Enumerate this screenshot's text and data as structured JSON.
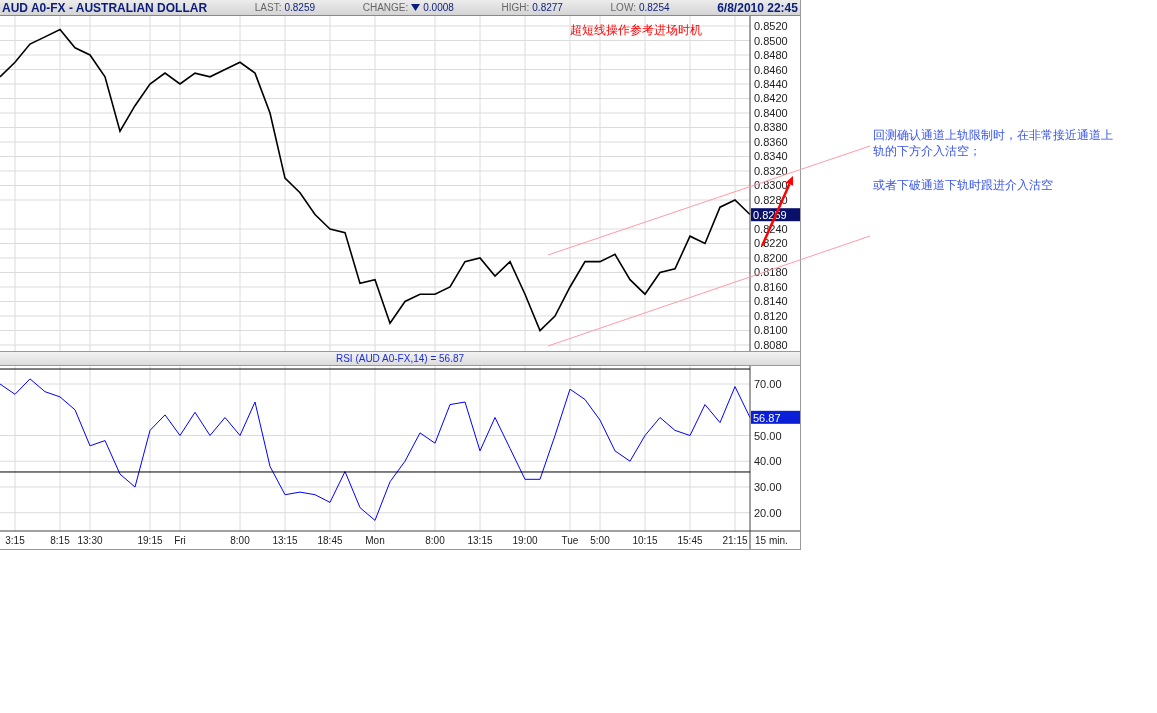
{
  "header": {
    "title": "AUD A0-FX - AUSTRALIAN DOLLAR",
    "fields": [
      {
        "label": "LAST:",
        "value": "0.8259"
      },
      {
        "label": "CHANGE:",
        "value": "0.0008",
        "falling": true
      },
      {
        "label": "HIGH:",
        "value": "0.8277"
      },
      {
        "label": "LOW:",
        "value": "0.8254"
      }
    ],
    "datetime": "6/8/2010 22:45"
  },
  "price_chart": {
    "last_label": "0.8259",
    "overlays": [
      {
        "kind": "channel_line"
      },
      {
        "kind": "channel_line"
      },
      {
        "kind": "arrow"
      }
    ],
    "chart_data": {
      "type": "line",
      "grid": true,
      "series": [
        {
          "color": "#000000",
          "values": [
            0.845,
            0.847,
            0.8495,
            0.8505,
            0.8515,
            0.849,
            0.848,
            0.845,
            0.8375,
            0.841,
            0.844,
            0.8455,
            0.844,
            0.8455,
            0.845,
            0.846,
            0.847,
            0.8455,
            0.84,
            0.831,
            0.829,
            0.826,
            0.824,
            0.8235,
            0.8165,
            0.817,
            0.811,
            0.814,
            0.815,
            0.815,
            0.816,
            0.8195,
            0.82,
            0.8175,
            0.8195,
            0.815,
            0.81,
            0.812,
            0.816,
            0.8195,
            0.8195,
            0.8205,
            0.817,
            0.815,
            0.818,
            0.8185,
            0.823,
            0.822,
            0.827,
            0.828,
            0.826
          ]
        }
      ],
      "ylim": [
        0.80717,
        0.85338
      ],
      "yticks": [
        {
          "value": 0.852,
          "label": "0.8520"
        },
        {
          "value": 0.85,
          "label": "0.8500"
        },
        {
          "value": 0.848,
          "label": "0.8480"
        },
        {
          "value": 0.846,
          "label": "0.8460"
        },
        {
          "value": 0.844,
          "label": "0.8440"
        },
        {
          "value": 0.842,
          "label": "0.8420"
        },
        {
          "value": 0.84,
          "label": "0.8400"
        },
        {
          "value": 0.838,
          "label": "0.8380"
        },
        {
          "value": 0.836,
          "label": "0.8360"
        },
        {
          "value": 0.834,
          "label": "0.8340"
        },
        {
          "value": 0.832,
          "label": "0.8320"
        },
        {
          "value": 0.83,
          "label": "0.8300"
        },
        {
          "value": 0.828,
          "label": "0.8280"
        },
        {
          "value": 0.824,
          "label": "0.8240"
        },
        {
          "value": 0.822,
          "label": "0.8220"
        },
        {
          "value": 0.82,
          "label": "0.8200"
        },
        {
          "value": 0.818,
          "label": "0.8180"
        },
        {
          "value": 0.816,
          "label": "0.8160"
        },
        {
          "value": 0.814,
          "label": "0.8140"
        },
        {
          "value": 0.812,
          "label": "0.8120"
        },
        {
          "value": 0.81,
          "label": "0.8100"
        },
        {
          "value": 0.808,
          "label": "0.8080"
        }
      ],
      "annotations": [
        "超短线操作参考进场时机"
      ]
    }
  },
  "rsi_chart": {
    "title": "RSI (AUD A0-FX,14) = 56.87",
    "last_label": "56.87",
    "overlays": [
      {
        "kind": "threshold_line"
      },
      {
        "kind": "threshold_line"
      }
    ],
    "chart_data": {
      "type": "line",
      "grid": true,
      "categories": [
        null,
        "3:15",
        null,
        null,
        "8:15",
        null,
        "13:30",
        null,
        null,
        null,
        "19:15",
        null,
        "Fri",
        null,
        null,
        null,
        "8:00",
        null,
        null,
        "13:15",
        null,
        null,
        "18:45",
        null,
        null,
        "Mon",
        null,
        null,
        null,
        "8:00",
        null,
        null,
        "13:15",
        null,
        null,
        "19:00",
        null,
        null,
        "Tue",
        null,
        "5:00",
        null,
        null,
        "10:15",
        null,
        null,
        "15:45",
        null,
        null,
        "21:15",
        null
      ],
      "series": [
        {
          "color": "#0000ff",
          "values": [
            70,
            66,
            72,
            67,
            65,
            60,
            46,
            48,
            35,
            30,
            52,
            58,
            50,
            59,
            50,
            57,
            50,
            63,
            38,
            27,
            28,
            27,
            24,
            36,
            22,
            17,
            32,
            40,
            51,
            47,
            62,
            63,
            44,
            57,
            45,
            33,
            33,
            50,
            68,
            64,
            56,
            44,
            40,
            50,
            57,
            52,
            50,
            62,
            55,
            69,
            57
          ]
        }
      ],
      "ylim": [
        12.9,
        77
      ],
      "yticks": [
        {
          "value": 20,
          "label": "20.00"
        },
        {
          "value": 30,
          "label": "30.00"
        },
        {
          "value": 40,
          "label": "40.00"
        },
        {
          "value": 50,
          "label": "50.00"
        },
        {
          "value": 70,
          "label": "70.00"
        }
      ],
      "xlabel": "15 min."
    }
  },
  "side_note": {
    "paragraphs": [
      "回测确认通道上轨限制时，在非常接近通道上轨的下方介入沽空；",
      "或者下破通道下轨时跟进介入沽空"
    ]
  }
}
